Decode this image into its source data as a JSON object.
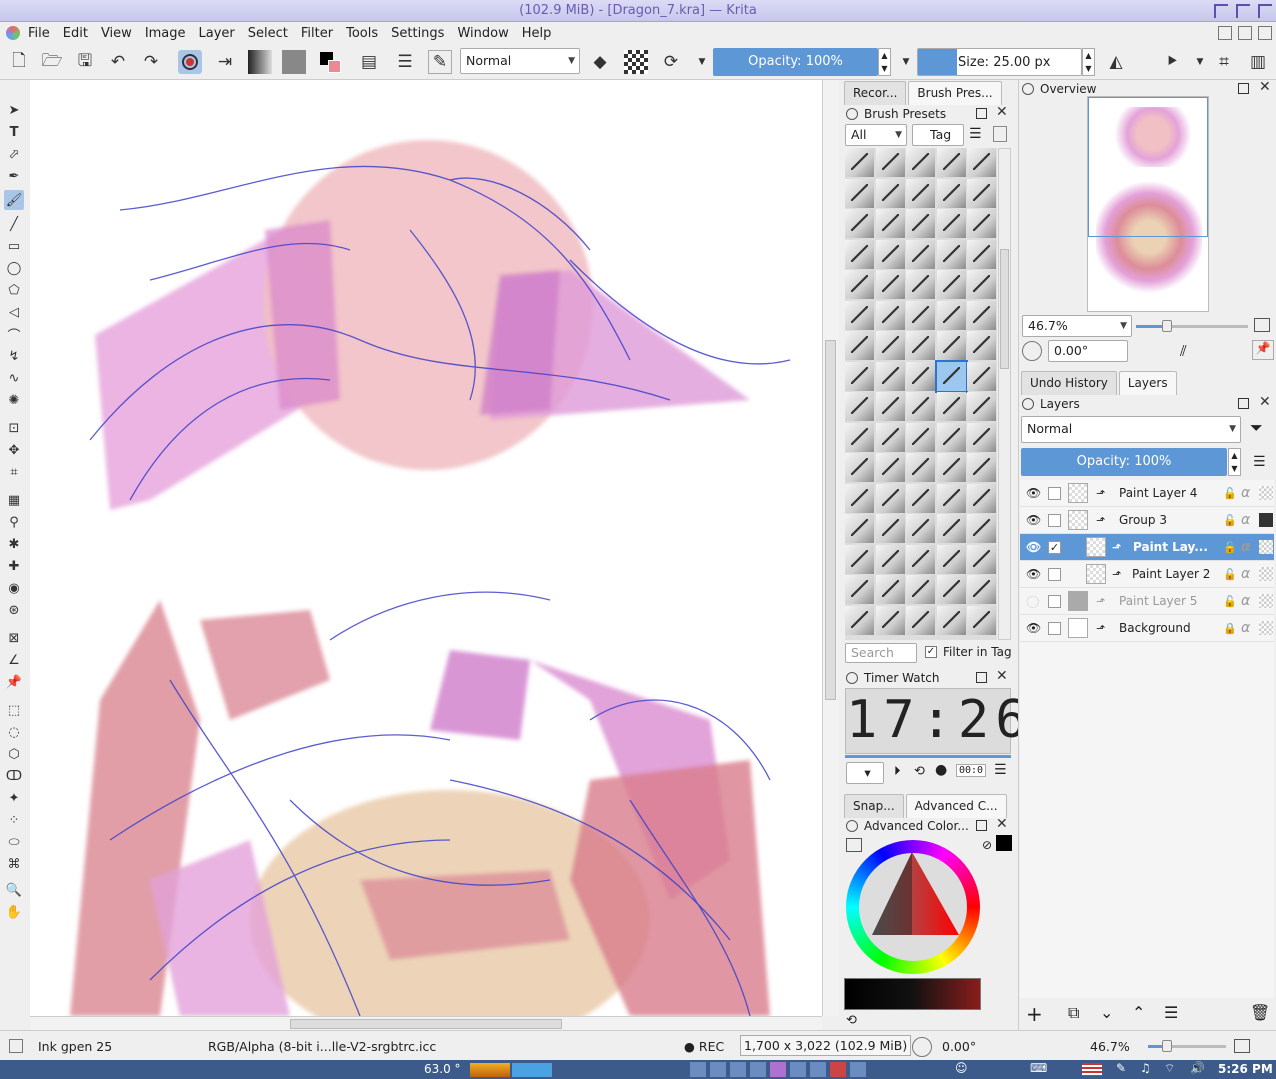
{
  "window": {
    "title": "(102.9 MiB)  - [Dragon_7.kra] — Krita"
  },
  "menu": [
    "File",
    "Edit",
    "View",
    "Image",
    "Layer",
    "Select",
    "Filter",
    "Tools",
    "Settings",
    "Window",
    "Help"
  ],
  "toolbar": {
    "blend_mode": "Normal",
    "opacity": "Opacity: 100%",
    "size": "Size: 25.00 px"
  },
  "brush_docker": {
    "tabs": [
      "Recor...",
      "Brush Pres..."
    ],
    "title": "Brush Presets",
    "filter": "All",
    "tag_label": "Tag",
    "search_placeholder": "Search",
    "filter_in_tag": "Filter in Tag"
  },
  "timer": {
    "title": "Timer Watch",
    "time": "17:26",
    "counter": "00:0"
  },
  "color_docker": {
    "tabs": [
      "Snap...",
      "Advanced C..."
    ],
    "title": "Advanced Color..."
  },
  "overview": {
    "title": "Overview",
    "zoom": "46.7%",
    "rotation": "0.00°"
  },
  "layers_panel": {
    "tabs": [
      "Undo History",
      "Layers"
    ],
    "title": "Layers",
    "blend_mode": "Normal",
    "opacity": "Opacity:  100%",
    "layers": [
      {
        "name": "Paint Layer 4",
        "visible": true
      },
      {
        "name": "Group 3",
        "visible": true
      },
      {
        "name": "Paint Lay...",
        "visible": true
      },
      {
        "name": "Paint Layer 2",
        "visible": true
      },
      {
        "name": "Paint Layer 5",
        "visible": false
      },
      {
        "name": "Background",
        "visible": true
      }
    ]
  },
  "status": {
    "brush": "Ink gpen 25",
    "colorspace": "RGB/Alpha (8-bit i...lle-V2-srgbtrc.icc",
    "rec": "REC",
    "dimensions": "1,700 x 3,022 (102.9 MiB)",
    "rotation": "0.00°",
    "zoom": "46.7%"
  },
  "taskbar": {
    "temp": "63.0 °",
    "clock": "5:26 PM"
  },
  "colors": {
    "accent": "#5e97d6",
    "title_text": "#6a5cb3"
  }
}
